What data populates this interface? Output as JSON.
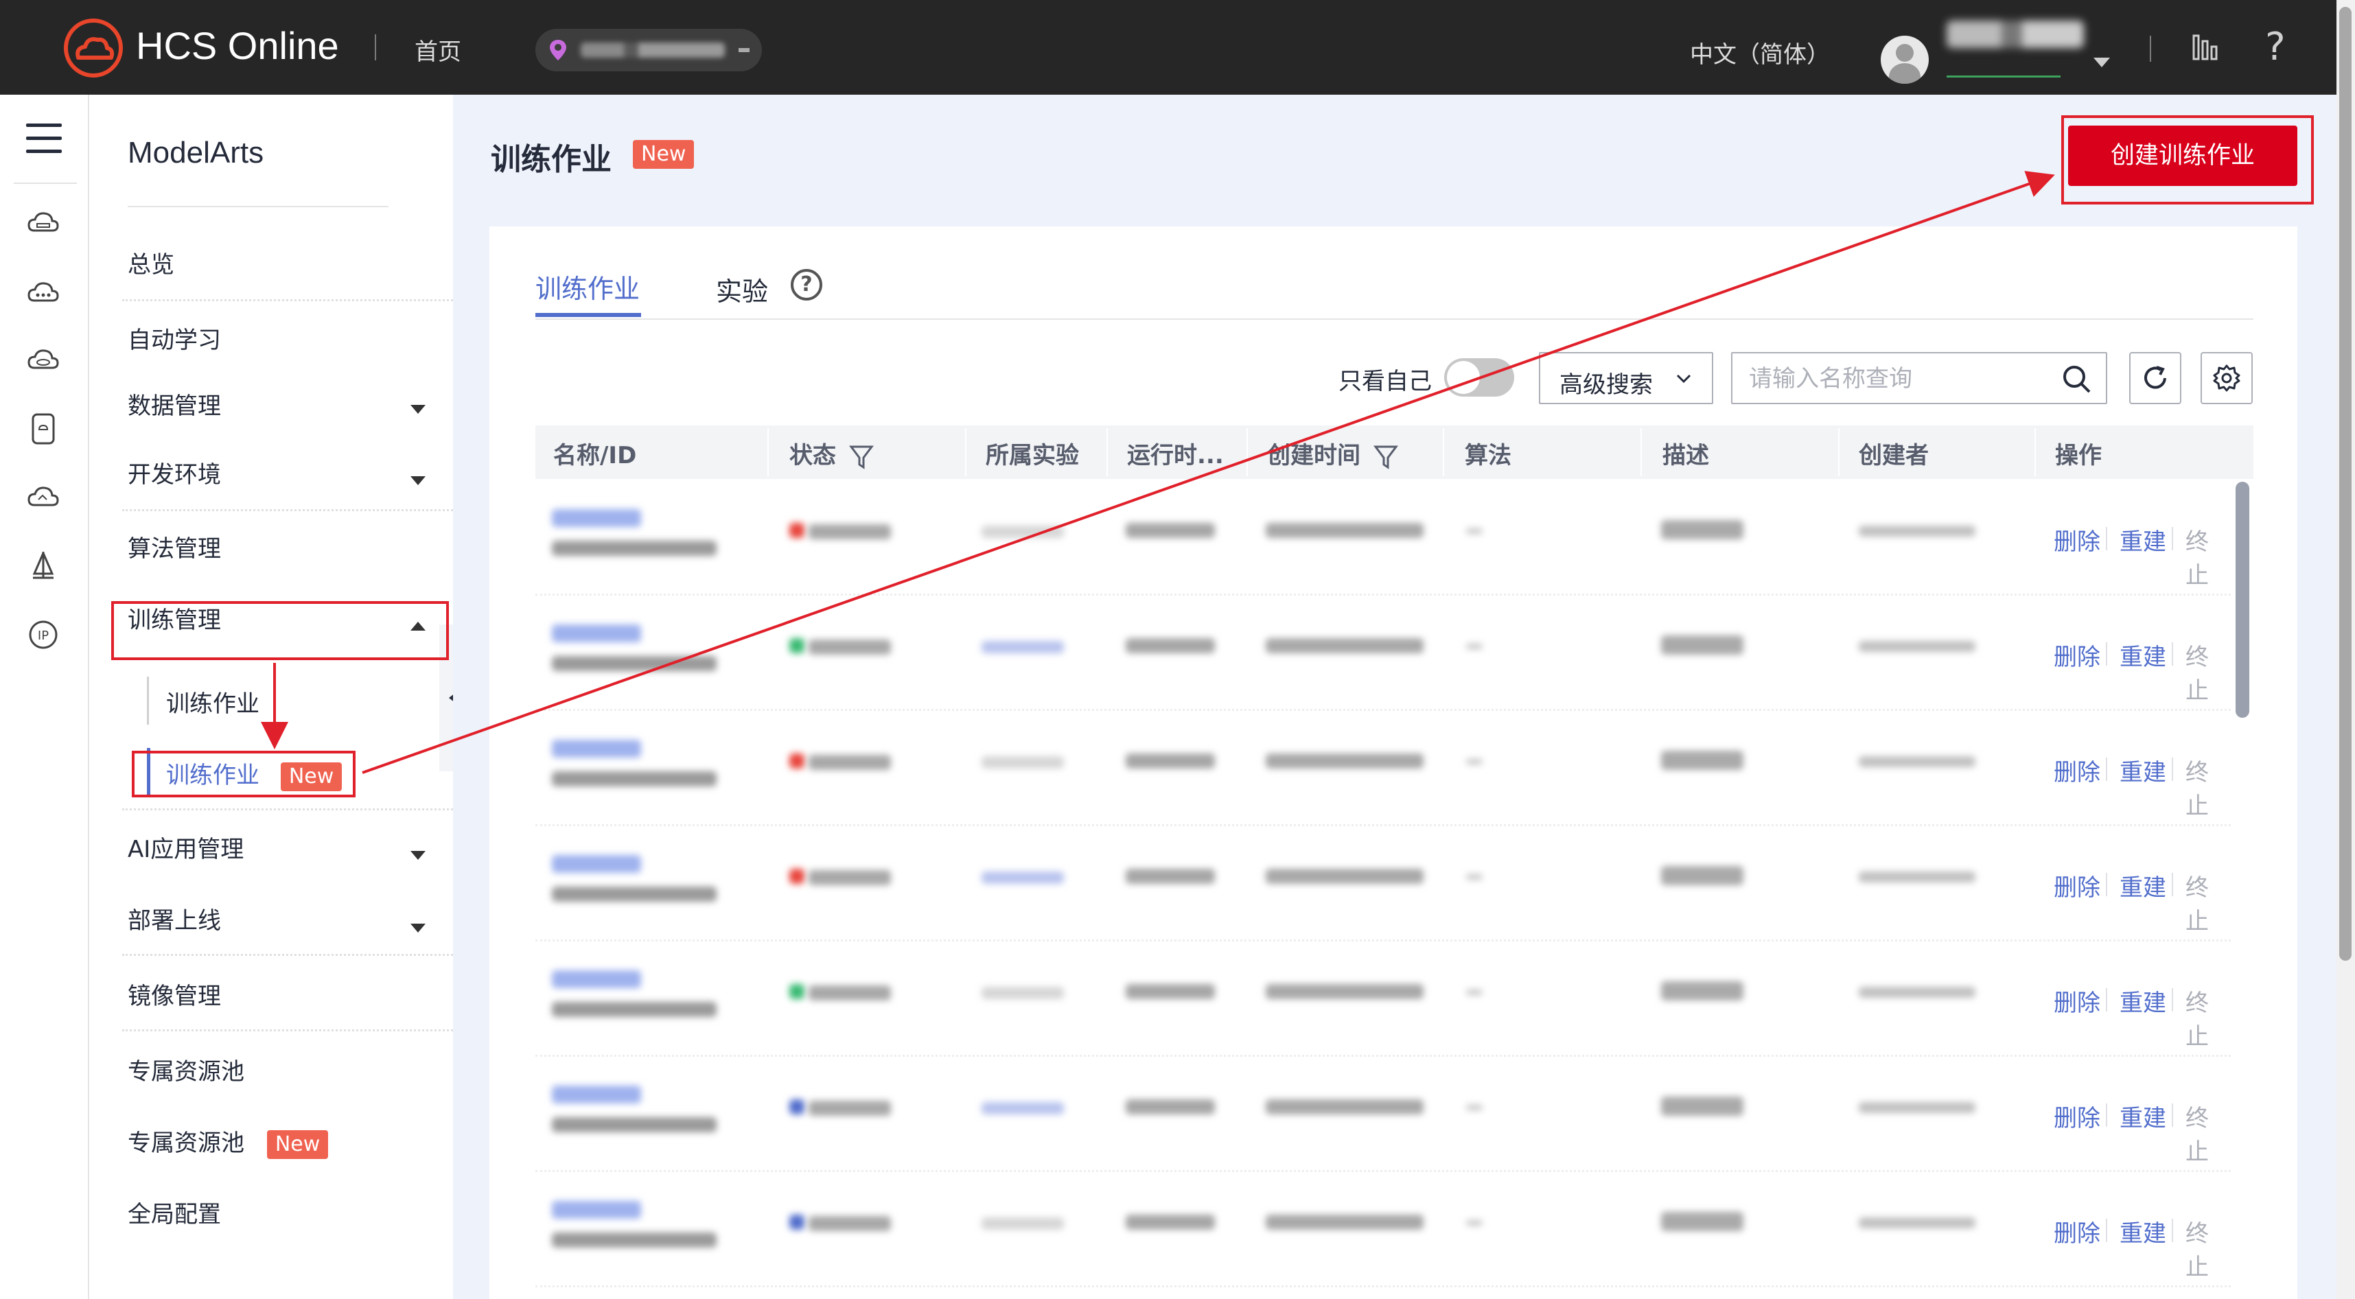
{
  "topbar": {
    "brand": "HCS Online",
    "home": "首页",
    "language": "中文（简体）"
  },
  "sidebar": {
    "title": "ModelArts",
    "items": [
      {
        "label": "总览"
      },
      {
        "label": "自动学习"
      },
      {
        "label": "数据管理"
      },
      {
        "label": "开发环境"
      },
      {
        "label": "算法管理"
      },
      {
        "label": "训练管理"
      },
      {
        "label": "训练作业"
      },
      {
        "label": "训练作业",
        "badge": "New"
      },
      {
        "label": "AI应用管理"
      },
      {
        "label": "部署上线"
      },
      {
        "label": "镜像管理"
      },
      {
        "label": "专属资源池"
      },
      {
        "label": "专属资源池",
        "badge": "New"
      },
      {
        "label": "全局配置"
      }
    ]
  },
  "page": {
    "title": "训练作业",
    "title_badge": "New",
    "create_button": "创建训练作业"
  },
  "tabs": [
    {
      "label": "训练作业",
      "active": true
    },
    {
      "label": "实验",
      "active": false
    }
  ],
  "toolbar": {
    "only_mine": "只看自己",
    "advanced_search": "高级搜索",
    "search_placeholder": "请输入名称查询"
  },
  "table": {
    "columns": [
      "名称/ID",
      "状态",
      "所属实验",
      "运行时...",
      "创建时间",
      "算法",
      "描述",
      "创建者",
      "操作"
    ],
    "actions": {
      "delete": "删除",
      "rebuild": "重建",
      "stop": "终止"
    }
  },
  "colors": {
    "accent": "#526ecc",
    "primary_button": "#d9001b",
    "badge": "#f06250",
    "annotation": "#e0202a",
    "topbar": "#262626"
  }
}
